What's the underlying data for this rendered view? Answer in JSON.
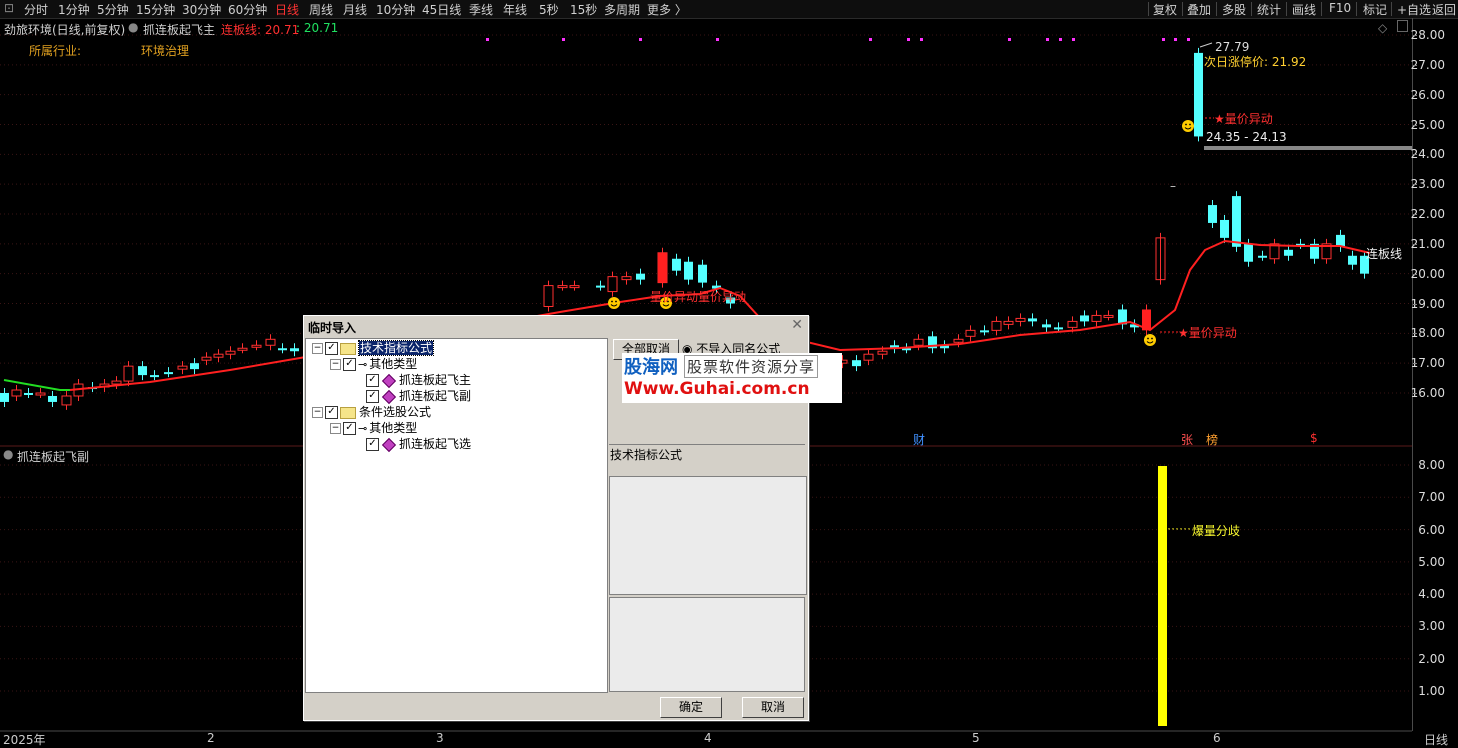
{
  "toolbar": {
    "periods": [
      "分时",
      "1分钟",
      "5分钟",
      "15分钟",
      "30分钟",
      "60分钟",
      "日线",
      "周线",
      "月线",
      "10分钟",
      "45日线",
      "季线",
      "年线",
      "5秒",
      "15秒",
      "多周期",
      "更多 〉"
    ],
    "active": "日线",
    "right": [
      "复权",
      "叠加",
      "多股",
      "统计",
      "画线",
      "F10",
      "+自选",
      "返回"
    ]
  },
  "info": {
    "stock_name": "劲旅环境(日线,前复权)",
    "indicator_main": "抓连板起飞主",
    "line_label": "连板线: 20.71",
    "line_value": ": 20.71",
    "industry_label": "所属行业:",
    "industry_value": "环境治理"
  },
  "chart": {
    "high_label": "27.79",
    "limit_up_label": "次日涨停价: 21.92",
    "range_label": "24.35 - 24.13",
    "annot_qty1": "★量价异动",
    "annot_qty2": "★量价异动",
    "annot_left": "量价异动量价异动",
    "line_name": "连板线",
    "marks": [
      "财",
      "张",
      "榜",
      "$"
    ]
  },
  "y_axis_main": [
    "28.00",
    "27.00",
    "26.00",
    "25.00",
    "24.00",
    "23.00",
    "22.00",
    "21.00",
    "20.00",
    "19.00",
    "18.00",
    "17.00",
    "16.00"
  ],
  "y_axis_sub": [
    "8.00",
    "7.00",
    "6.00",
    "5.00",
    "4.00",
    "3.00",
    "2.00",
    "1.00"
  ],
  "sub_panel": {
    "title": "抓连板起飞副",
    "annot": "爆量分歧"
  },
  "x_axis": [
    "2025年",
    "2",
    "3",
    "4",
    "5",
    "6"
  ],
  "x_axis_right": "日线",
  "dialog": {
    "title": "临时导入",
    "tree": [
      {
        "label": "技术指标公式",
        "level": 0,
        "kind": "folder"
      },
      {
        "label": "其他类型",
        "level": 1,
        "kind": "key"
      },
      {
        "label": "抓连板起飞主",
        "level": 2,
        "kind": "item"
      },
      {
        "label": "抓连板起飞副",
        "level": 2,
        "kind": "item"
      },
      {
        "label": "条件选股公式",
        "level": 0,
        "kind": "folder"
      },
      {
        "label": "其他类型",
        "level": 1,
        "kind": "key"
      },
      {
        "label": "抓连板起飞选",
        "level": 2,
        "kind": "item"
      }
    ],
    "btn_select_all": "全部取消",
    "radio_label": "不导入同名公式",
    "type_label": "技术指标公式",
    "ok": "确定",
    "cancel": "取消",
    "watermark_1": "股海网",
    "watermark_2": "股票软件资源分享",
    "watermark_3": "Www.Guhai.com.cn"
  }
}
